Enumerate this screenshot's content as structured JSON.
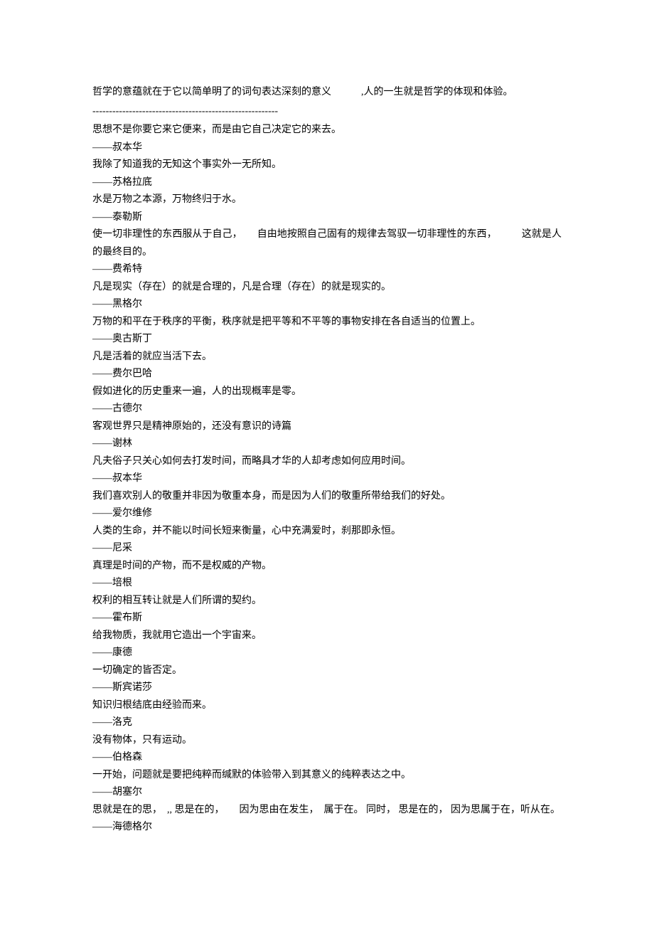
{
  "intro": "哲学的意蕴就在于它以简单明了的词句表达深刻的意义　　　,人的一生就是哲学的体现和体验。",
  "divider": "--------------------------------------------------------",
  "quotes": [
    {
      "text": "思想不是你要它来它便来，而是由它自己决定它的来去。",
      "author": "——叔本华"
    },
    {
      "text": "我除了知道我的无知这个事实外一无所知。",
      "author": "——苏格拉底"
    },
    {
      "text": "水是万物之本源，万物终归于水。",
      "author": "——泰勒斯"
    },
    {
      "text": "使一切非理性的东西服从于自己，　　自由地按照自己固有的规律去驾驭一切非理性的东西，　　　这就是人的最终目的。",
      "author": "——费希特"
    },
    {
      "text": "凡是现实（存在）的就是合理的，凡是合理（存在）的就是现实的。",
      "author": "——黑格尔"
    },
    {
      "text": "万物的和平在于秩序的平衡，秩序就是把平等和不平等的事物安排在各自适当的位置上。",
      "author": "——奥古斯丁"
    },
    {
      "text": "凡是活着的就应当活下去。",
      "author": "——费尔巴哈"
    },
    {
      "text": "假如进化的历史重来一遍，人的出现概率是零。",
      "author": "——古德尔"
    },
    {
      "text": "客观世界只是精神原始的，还没有意识的诗篇",
      "author": "——谢林"
    },
    {
      "text": "凡夫俗子只关心如何去打发时间，而略具才华的人却考虑如何应用时间。",
      "author": "——叔本华"
    },
    {
      "text": "我们喜欢别人的敬重并非因为敬重本身，而是因为人们的敬重所带给我们的好处。",
      "author": "——爱尔维修"
    },
    {
      "text": "人类的生命，并不能以时间长短来衡量，心中充满爱时，刹那即永恒。",
      "author": "——尼采"
    },
    {
      "text": "真理是时间的产物，而不是权威的产物。",
      "author": "——培根"
    },
    {
      "text": "权利的相互转让就是人们所谓的契约。",
      "author": "——霍布斯"
    },
    {
      "text": "给我物质，我就用它造出一个宇宙来。",
      "author": "——康德"
    },
    {
      "text": "一切确定的皆否定。",
      "author": "——斯宾诺莎"
    },
    {
      "text": "知识归根结底由经验而来。",
      "author": "——洛克"
    },
    {
      "text": "没有物体，只有运动。",
      "author": "——伯格森"
    },
    {
      "text": "一开始，问题就是要把纯粹而缄默的体验带入到其意义的纯粹表达之中。",
      "author": "——胡塞尔"
    },
    {
      "text": "思就是在的思，　,, 思是在的，　　因为思由在发生，　属于在。 同时， 思是在的， 因为思属于在，听从在。",
      "author": "——海德格尔"
    }
  ]
}
